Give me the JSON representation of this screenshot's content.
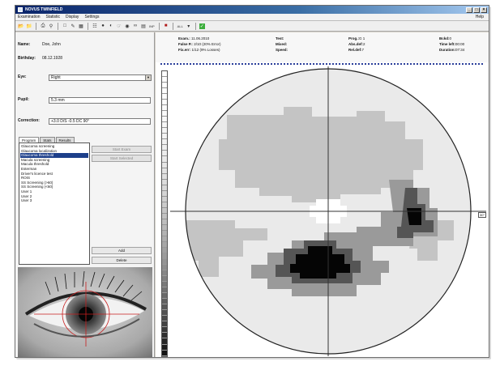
{
  "window": {
    "title": "NOVUS    TWINFIELD"
  },
  "menu": [
    "Examination",
    "Statistic",
    "Display",
    "Settings"
  ],
  "menu_help": "Help",
  "toolbar": {
    "icons": [
      "open-folder-icon",
      "folder-icon",
      "print-icon",
      "preview-icon",
      "box-icon",
      "pen-icon",
      "table-icon",
      "grid-icon",
      "head-icon",
      "head-side-icon",
      "hand-icon",
      "eye-icon",
      "link-icon",
      "doc-icon",
      "export-icon",
      "record-icon",
      "calendar-icon",
      "green-icon"
    ],
    "ins_label": "INP",
    "mode_label": "ALL"
  },
  "patient": {
    "name_label": "Name:",
    "name_value": "Doe, John",
    "birthday_label": "Birthday:",
    "birthday_value": "08.12.1928",
    "eye_label": "Eye:",
    "eye_value": "Right",
    "pupil_label": "Pupil:",
    "pupil_value": "5.3 mm",
    "correction_label": "Correction:",
    "correction_value": "+3.0 D/S -0.5 DC 90°"
  },
  "tabs": [
    "Program",
    "Stats",
    "Results"
  ],
  "programs": [
    "Glaucoma screening",
    "Glaucoma localization",
    "Glaucoma threshold",
    "Macula screening",
    "Macula threshold",
    "Esterman",
    "Driver's licence test",
    "ROIS",
    "SS Screening (>60)",
    "SS Screening (<60)",
    "User 1",
    "User 2",
    "User 3"
  ],
  "selected_program_index": 2,
  "buttons": {
    "new_exam": "Start Exam",
    "next_exam": "Start Selected",
    "add": "Add",
    "delete": "Delete"
  },
  "stats": {
    "exam_label": "Exam.:",
    "exam_value": "11.06.2010",
    "false_label": "False P.:",
    "false_value": "2/10 (20% Error)",
    "fix_label": "Fix.err:",
    "fix_value": "1/12 (9% Losses)",
    "test_label": "Test:",
    "mixed_label": "Mixed:",
    "speed_label": "Speed:",
    "prog_label": "Prog.:",
    "prog_value": "G 1",
    "abs_label": "Abs.def:",
    "abs_value": "2",
    "rel_label": "Rel.def:",
    "rel_value": "7",
    "bkgd_label": "Bckd:",
    "bkgd_value": "0",
    "time_label": "Time left:",
    "time_value": "00:00",
    "dur_label": "Duration:",
    "dur_value": "07:34"
  },
  "plot": {
    "zoom_label": "30°",
    "colors": {
      "field": "#eaeaea",
      "light": "#c4c4c4",
      "mid": "#9a9a9a",
      "dark": "#555555",
      "black": "#050505"
    }
  }
}
